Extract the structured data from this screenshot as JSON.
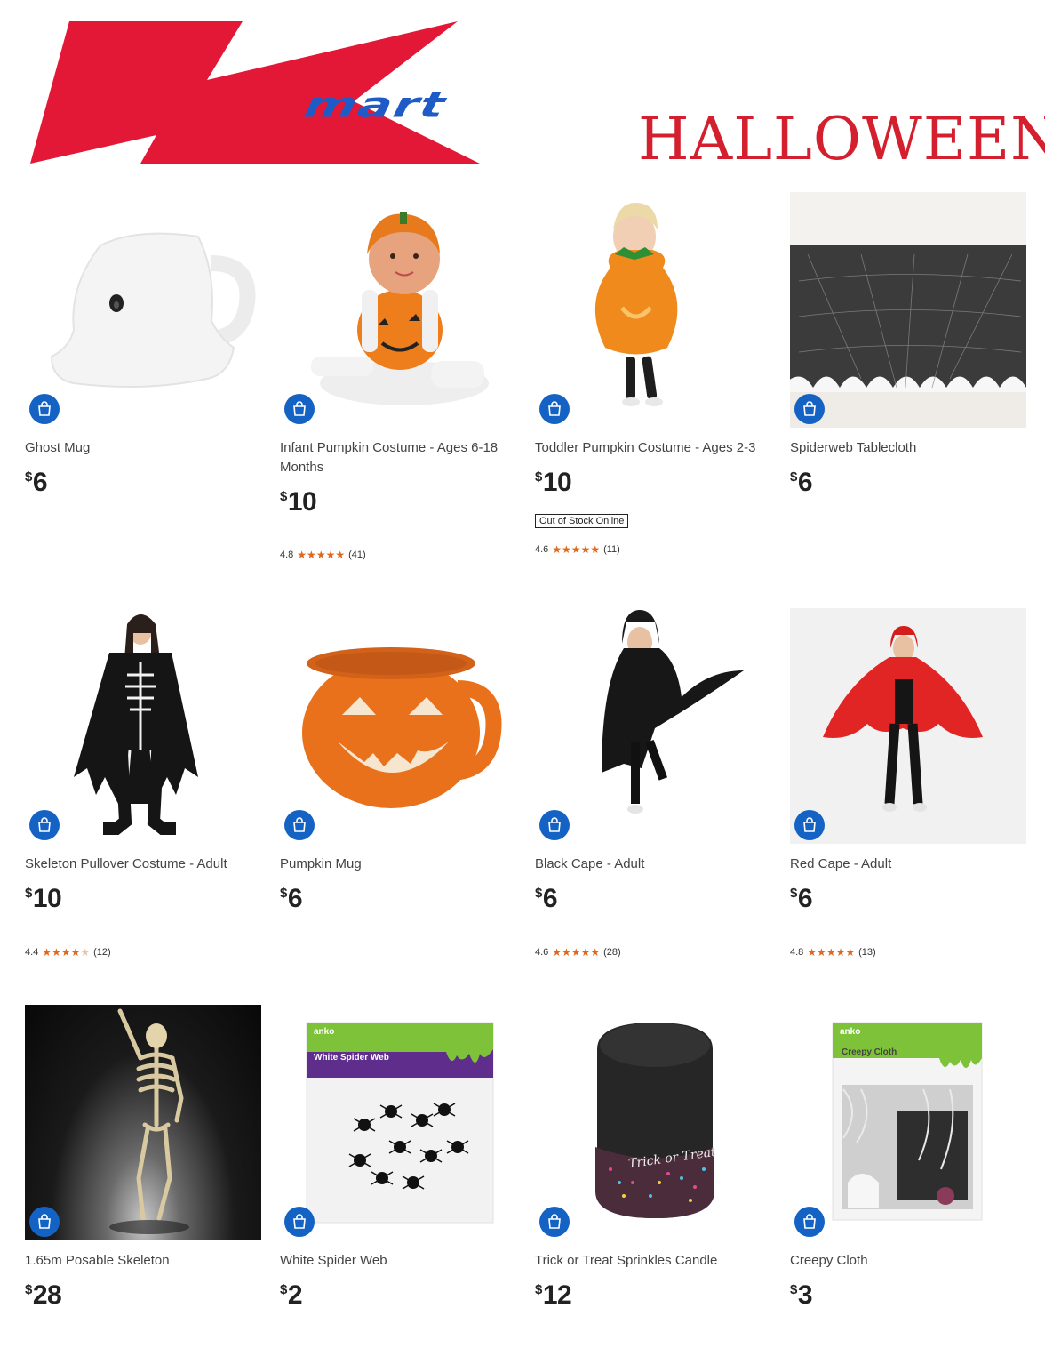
{
  "brand": {
    "logo_text": "mart",
    "logo_red": "#e31837",
    "logo_blue": "#1e5bc6"
  },
  "banner": {
    "title": "HALLOWEEN",
    "color": "#d41f2f"
  },
  "accent": "#1463c4",
  "star_color": "#e0671b",
  "products": [
    {
      "name": "Ghost Mug",
      "currency": "$",
      "price": "6"
    },
    {
      "name": "Infant Pumpkin Costume - Ages 6-18 Months",
      "currency": "$",
      "price": "10",
      "rating": "4.8",
      "stars": 4.8,
      "reviews": "(41)"
    },
    {
      "name": "Toddler Pumpkin Costume - Ages 2-3",
      "currency": "$",
      "price": "10",
      "badge": "Out of Stock Online",
      "rating": "4.6",
      "stars": 4.6,
      "reviews": "(11)"
    },
    {
      "name": "Spiderweb Tablecloth",
      "currency": "$",
      "price": "6"
    },
    {
      "name": "Skeleton Pullover Costume - Adult",
      "currency": "$",
      "price": "10",
      "rating": "4.4",
      "stars": 4.4,
      "reviews": "(12)"
    },
    {
      "name": "Pumpkin Mug",
      "currency": "$",
      "price": "6"
    },
    {
      "name": "Black Cape - Adult",
      "currency": "$",
      "price": "6",
      "rating": "4.6",
      "stars": 4.6,
      "reviews": "(28)"
    },
    {
      "name": "Red Cape - Adult",
      "currency": "$",
      "price": "6",
      "rating": "4.8",
      "stars": 4.8,
      "reviews": "(13)"
    },
    {
      "name": "1.65m Posable Skeleton",
      "currency": "$",
      "price": "28"
    },
    {
      "name": "White Spider Web",
      "currency": "$",
      "price": "2",
      "package_brand": "anko",
      "package_label": "White Spider Web"
    },
    {
      "name": "Trick or Treat Sprinkles Candle",
      "currency": "$",
      "price": "12",
      "candle_label": "Trick or Treat"
    },
    {
      "name": "Creepy Cloth",
      "currency": "$",
      "price": "3",
      "package_brand": "anko",
      "package_label": "Creepy Cloth"
    }
  ]
}
